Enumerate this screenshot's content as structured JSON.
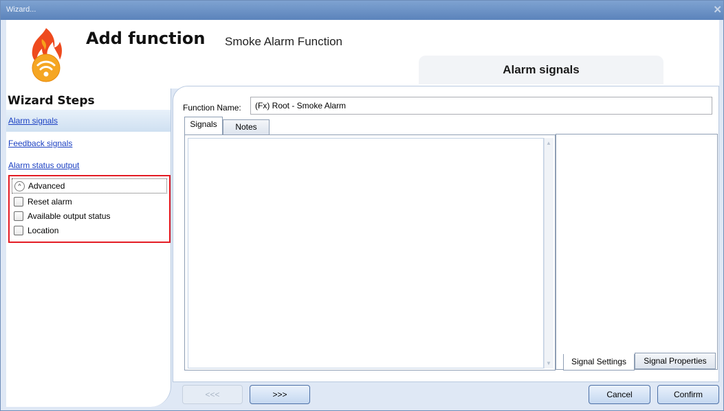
{
  "window": {
    "title": "Wizard...",
    "close_glyph": "✕"
  },
  "header": {
    "heading": "Add function",
    "subtitle": "Smoke Alarm Function",
    "current_step": "Alarm signals",
    "logo_icon": "flame-wireless-icon"
  },
  "steps": {
    "title": "Wizard Steps",
    "items": [
      {
        "label": "Alarm signals",
        "active": true
      },
      {
        "label": "Feedback signals",
        "active": false
      },
      {
        "label": "Alarm status output",
        "active": false
      }
    ],
    "advanced": {
      "label": "Advanced",
      "toggle_glyph": "^",
      "options": [
        {
          "label": "Reset alarm",
          "checked": false
        },
        {
          "label": "Available output status",
          "checked": false
        },
        {
          "label": "Location",
          "checked": false
        }
      ]
    }
  },
  "main": {
    "function_name_label": "Function Name:",
    "function_name_value": "(Fx) Root - Smoke Alarm",
    "tabs": [
      {
        "label": "Signals",
        "active": true
      },
      {
        "label": "Notes",
        "active": false
      }
    ],
    "bottom_tabs": [
      {
        "label": "Signal Settings",
        "active": true
      },
      {
        "label": "Signal Properties",
        "active": false
      }
    ],
    "scroll_up_glyph": "▲",
    "scroll_down_glyph": "▼"
  },
  "footer": {
    "back_label": "<<<",
    "next_label": ">>>",
    "cancel_label": "Cancel",
    "confirm_label": "Confirm"
  },
  "colors": {
    "highlight_box": "#e31b23",
    "title_bar": "#6a8fc6",
    "link": "#1a3fc2"
  }
}
